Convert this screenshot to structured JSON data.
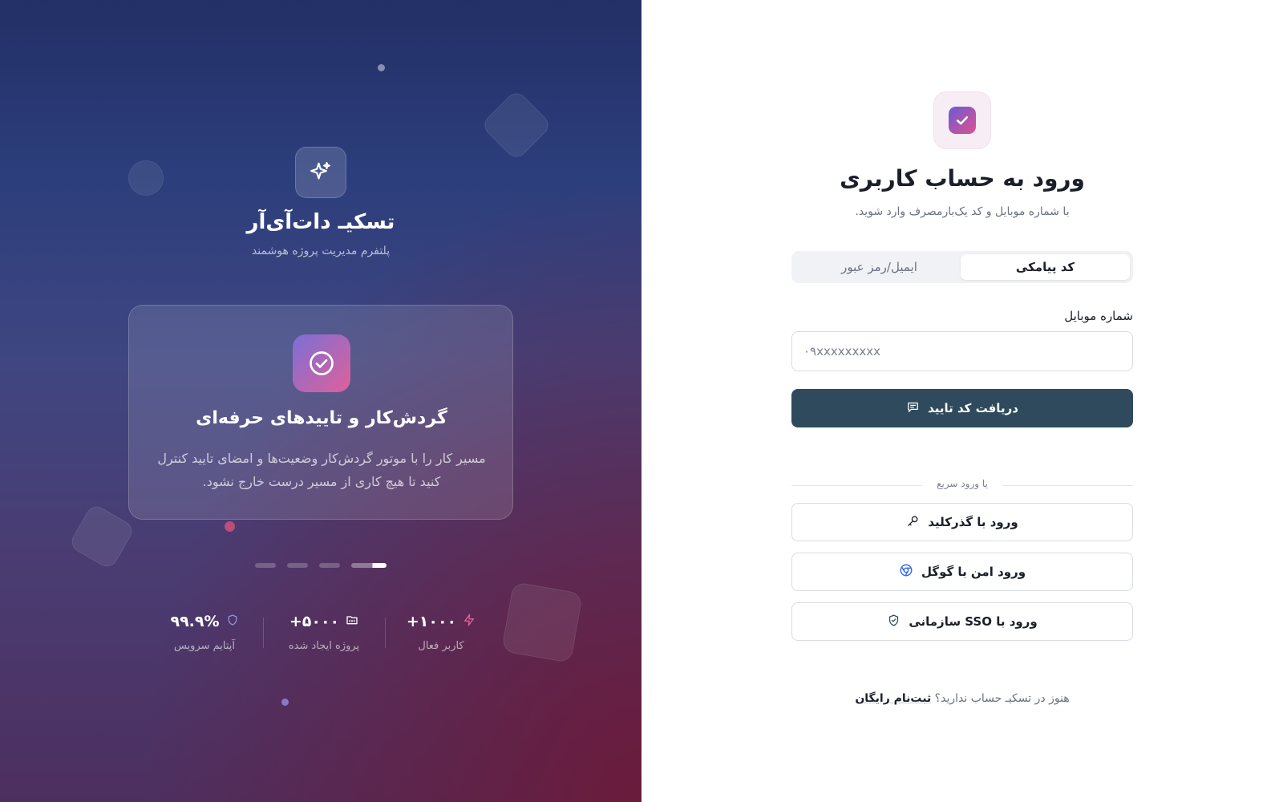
{
  "brand": {
    "title": "تسکیـ دات‌آی‌آر",
    "subtitle": "پلتفرم مدیریت پروژه هوشمند"
  },
  "feature": {
    "title": "گردش‌کار و تاییدهای حرفه‌ای",
    "description": "مسیر کار را با موتور گردش‌کار وضعیت‌ها و امضای تایید کنترل کنید تا هیچ کاری از مسیر درست خارج نشود.",
    "slides_total": 4,
    "active_slide": 4
  },
  "stats": [
    {
      "value": "۹۹.۹%",
      "label": "آپتایم سرویس",
      "icon": "shield-icon"
    },
    {
      "value": "+۵۰۰۰",
      "label": "پروژه ایجاد شده",
      "icon": "folder-icon"
    },
    {
      "value": "+۱۰۰۰",
      "label": "کاربر فعال",
      "icon": "lightning-icon"
    }
  ],
  "login": {
    "title": "ورود به حساب کاربری",
    "subtitle": "با شماره موبایل و کد یک‌بارمصرف وارد شوید.",
    "tabs": [
      {
        "label": "کد پیامکی",
        "active": true
      },
      {
        "label": "ایمیل/رمز عبور",
        "active": false
      }
    ],
    "mobile_label": "شماره موبایل",
    "mobile_placeholder": "۰۹xxxxxxxxx",
    "mobile_value": "",
    "submit_label": "دریافت کد تایید",
    "divider_label": "یا ورود سریع",
    "alt_buttons": [
      {
        "label": "ورود با گذرکلید",
        "icon": "key-icon"
      },
      {
        "label": "ورود امن با گوگل",
        "icon": "google-icon"
      },
      {
        "label": "ورود با SSO سازمانی",
        "icon": "shield-check-icon"
      }
    ],
    "signup_prompt": "هنوز در تسکیـ حساب ندارید؟",
    "signup_link": "ثبت‌نام رایگان"
  },
  "colors": {
    "primary_button": "#2f4a5c",
    "accent_gradient_start": "#7b6fd6",
    "accent_gradient_end": "#e0609a",
    "left_panel_top": "#232f66",
    "left_panel_bottom": "#4d2f5f"
  }
}
